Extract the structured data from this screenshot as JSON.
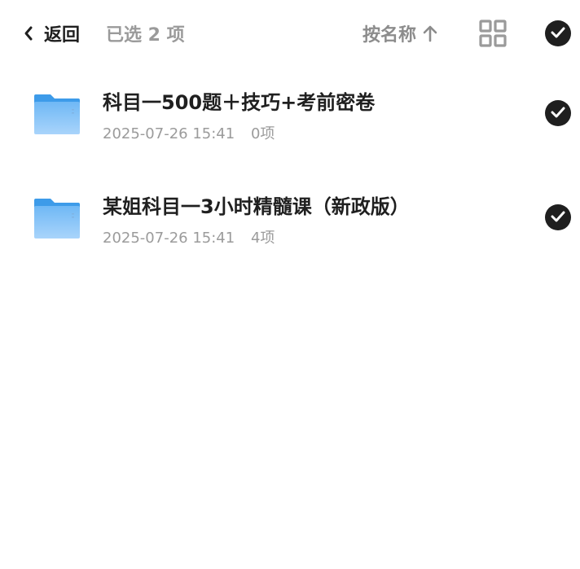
{
  "header": {
    "back_label": "返回",
    "selected_label": "已选 2 项",
    "sort_label": "按名称",
    "sort_direction_icon": "arrow-up-icon",
    "view_toggle_icon": "grid-view-icon",
    "select_all_icon": "check-circle-icon"
  },
  "items": [
    {
      "name": "科目一500题＋技巧+考前密卷",
      "date": "2025-07-26 15:41",
      "count": "0项",
      "icon": "folder-icon",
      "selected": true
    },
    {
      "name": "某姐科目一3小时精髓课（新政版）",
      "date": "2025-07-26 15:41",
      "count": "4项",
      "icon": "folder-icon",
      "selected": true
    }
  ],
  "colors": {
    "text_primary": "#1f1f1f",
    "text_secondary": "#9b9b9b",
    "check_bg": "#1f1f1f",
    "folder_blue": "#4aa3ef"
  }
}
